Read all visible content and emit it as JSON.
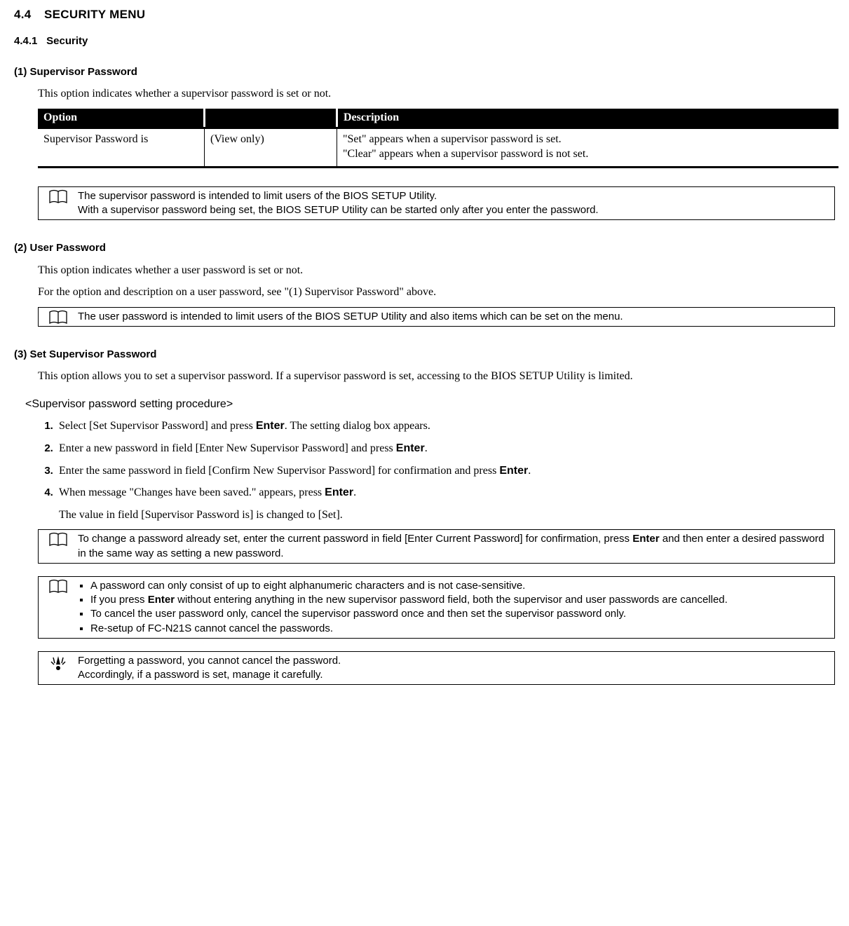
{
  "headings": {
    "h_main_num": "4.4",
    "h_main_title": "SECURITY MENU",
    "h_sub_num": "4.4.1",
    "h_sub_title": "Security",
    "h1": "(1) Supervisor Password",
    "h2": "(2) User Password",
    "h3": "(3) Set Supervisor Password"
  },
  "p1": "This option indicates whether a supervisor password is set or not.",
  "table": {
    "head_option": "Option",
    "head_blank": "",
    "head_desc": "Description",
    "row1_c1": "Supervisor Password is",
    "row1_c2": "(View only)",
    "row1_c3a": "\"Set\" appears when a supervisor password is set.",
    "row1_c3b": "\"Clear\" appears when a supervisor password is not set."
  },
  "note1a": "The supervisor password is intended to limit users of the BIOS SETUP Utility.",
  "note1b": "With a supervisor password being set, the BIOS SETUP Utility can be started only after you enter the password.",
  "p2a": "This option indicates whether a user password is set or not.",
  "p2b": "For the option and description on a user password, see \"(1) Supervisor Password\" above.",
  "note2": "The user password is intended to limit users of the BIOS SETUP Utility and also items which can be set on the menu.",
  "p3": "This option allows you to set a supervisor password. If a supervisor password is set, accessing to the BIOS SETUP Utility is limited.",
  "proc_title": "<Supervisor password setting procedure>",
  "steps": {
    "s1a": "Select [Set Supervisor Password] and press ",
    "s1b": "Enter",
    "s1c": ". The setting dialog box appears.",
    "s2a": "Enter a new password in field [Enter New Supervisor Password] and press ",
    "s2b": "Enter",
    "s2c": ".",
    "s3a": "Enter the same password in field [Confirm New Supervisor Password] for confirmation and press ",
    "s3b": "Enter",
    "s3c": ".",
    "s4a": "When message \"Changes have been saved.\" appears, press ",
    "s4b": "Enter",
    "s4c": ".",
    "s4extra": "The value in field [Supervisor Password is] is changed to [Set]."
  },
  "note3a": "To change a password already set, enter the current password in field [Enter Current Password] for confirmation, press ",
  "note3b": "Enter",
  "note3c": " and then enter a desired password in the same way as setting a new password.",
  "note4": {
    "li1": "A password can only consist of up to eight alphanumeric characters and is not case-sensitive.",
    "li2a": "If you press ",
    "li2b": "Enter",
    "li2c": " without entering anything in the new supervisor password field, both the supervisor and user passwords are cancelled.",
    "li3": "To cancel the user password only, cancel the supervisor password once and then set the supervisor password only.",
    "li4": "Re-setup of FC-N21S cannot cancel the passwords."
  },
  "note5a": "Forgetting a password, you cannot cancel the password.",
  "note5b": "Accordingly, if a password is set, manage it carefully."
}
